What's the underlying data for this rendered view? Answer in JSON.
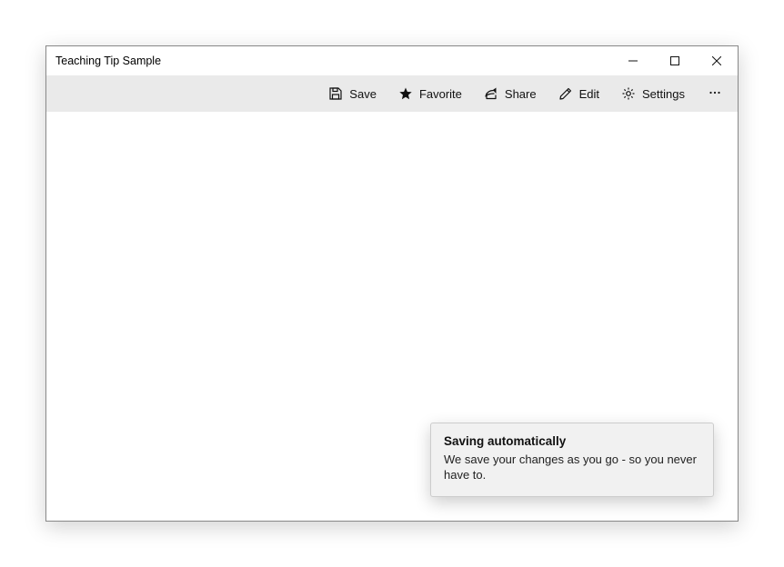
{
  "window": {
    "title": "Teaching Tip Sample"
  },
  "commandbar": {
    "save_label": "Save",
    "favorite_label": "Favorite",
    "share_label": "Share",
    "edit_label": "Edit",
    "settings_label": "Settings"
  },
  "tip": {
    "title": "Saving automatically",
    "body": "We save your changes as you go - so you never have to."
  }
}
